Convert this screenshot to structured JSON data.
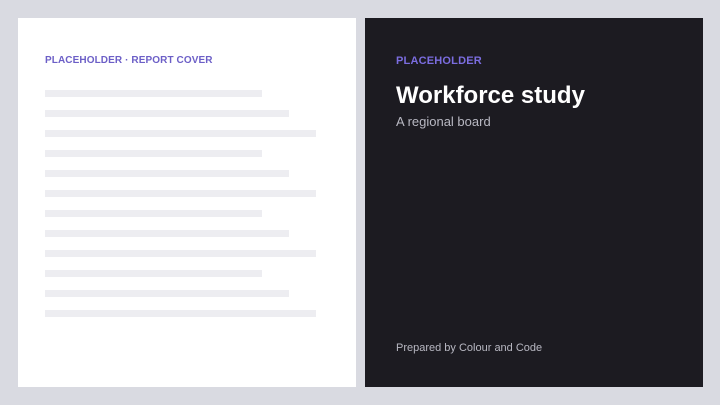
{
  "left_panel": {
    "label": "PLACEHOLDER · REPORT COVER",
    "lines_count_visible": 12
  },
  "right_panel": {
    "eyebrow": "PLACEHOLDER",
    "title": "Workforce study",
    "subtitle": "A regional board",
    "footer": "Prepared by Colour and Code"
  },
  "colors": {
    "page_background": "#d9dae1",
    "left_background": "#ffffff",
    "placeholder_line": "#ededf1",
    "accent": "#6c5fc7",
    "accent_dark_bg": "#7b6de0",
    "right_background": "#1c1b21",
    "title_text": "#ffffff",
    "muted_text": "#b8b8c2"
  }
}
